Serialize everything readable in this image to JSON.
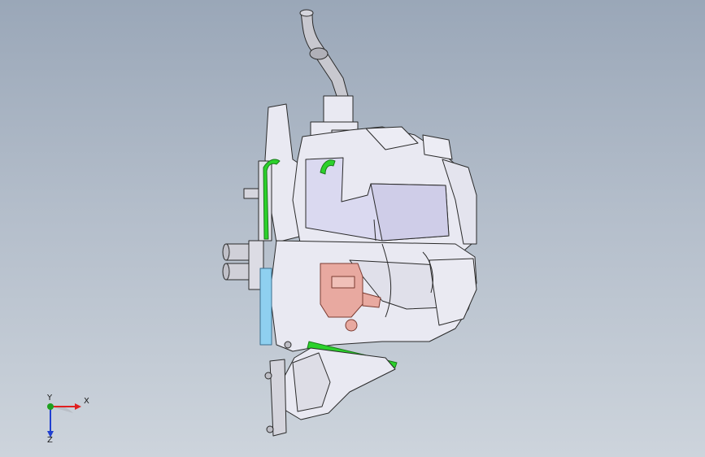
{
  "viewport": {
    "background_top": "#9aa7b8",
    "background_bottom": "#cdd4dc"
  },
  "model": {
    "icon": "hvac-assembly-3d-model",
    "colors": {
      "body": "#e9e9f2",
      "edge": "#2a2a2a",
      "tube": "#bfbfc6",
      "highlight_green": "#2bd12b",
      "bracket_pink": "#e8a9a0",
      "filter_blue": "#8fd0f0"
    }
  },
  "triad": {
    "x_label": "X",
    "y_label": "Y",
    "z_label": "Z",
    "colors": {
      "x": "#e02020",
      "y": "#1ea01e",
      "z": "#2040d0"
    }
  }
}
